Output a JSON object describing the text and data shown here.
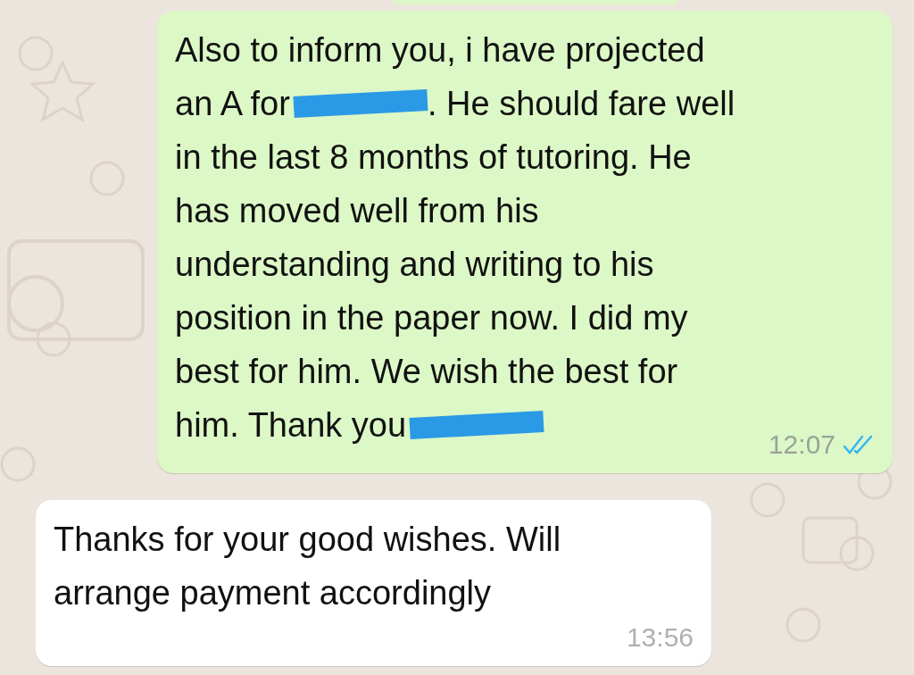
{
  "messages": [
    {
      "kind": "sent",
      "lines": [
        [
          {
            "kind": "text",
            "text": "Also to inform you, i have projected"
          }
        ],
        [
          {
            "kind": "text",
            "text": "an A for"
          },
          {
            "kind": "redaction"
          },
          {
            "kind": "text",
            "text": ". He should fare well"
          }
        ],
        [
          {
            "kind": "text",
            "text": "in the last 8 months of tutoring. He"
          }
        ],
        [
          {
            "kind": "text",
            "text": "has moved well from his"
          }
        ],
        [
          {
            "kind": "text",
            "text": "understanding and writing to his"
          }
        ],
        [
          {
            "kind": "text",
            "text": "position in the paper now. I did my"
          }
        ],
        [
          {
            "kind": "text",
            "text": "best for him. We wish the best for"
          }
        ],
        [
          {
            "kind": "text",
            "text": "him. Thank you"
          },
          {
            "kind": "redaction"
          }
        ]
      ],
      "time": "12:07",
      "read": true
    },
    {
      "kind": "received",
      "lines": [
        [
          {
            "kind": "text",
            "text": "Thanks for your good wishes. Will"
          }
        ],
        [
          {
            "kind": "text",
            "text": "arrange payment accordingly"
          }
        ]
      ],
      "time": "13:56"
    }
  ]
}
